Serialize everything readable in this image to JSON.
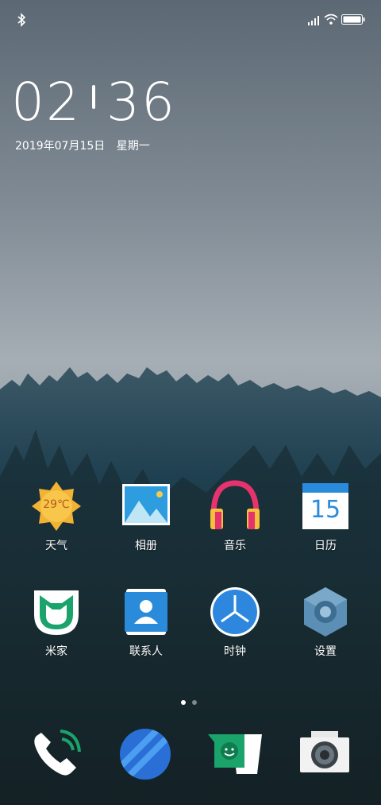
{
  "status_bar": {
    "bluetooth": "bluetooth-icon",
    "signal": "signal-icon",
    "wifi": "wifi-icon",
    "battery": "battery-icon"
  },
  "clock": {
    "hours": "02",
    "minutes": "36"
  },
  "date": {
    "day": "2019年07月15日",
    "weekday": "星期一"
  },
  "weather": {
    "temp": "29℃"
  },
  "apps_row1": [
    {
      "label": "天气",
      "icon": "weather-sun-icon"
    },
    {
      "label": "相册",
      "icon": "gallery-icon"
    },
    {
      "label": "音乐",
      "icon": "headphones-icon"
    },
    {
      "label": "日历",
      "icon": "calendar-icon",
      "day": "15"
    }
  ],
  "apps_row2": [
    {
      "label": "米家",
      "icon": "mijia-icon"
    },
    {
      "label": "联系人",
      "icon": "contacts-icon"
    },
    {
      "label": "时钟",
      "icon": "clock-icon"
    },
    {
      "label": "设置",
      "icon": "settings-gear-icon"
    }
  ],
  "page_indicator": {
    "pages": 2,
    "active": 0
  },
  "dock": [
    {
      "icon": "phone-icon"
    },
    {
      "icon": "browser-icon"
    },
    {
      "icon": "messages-icon"
    },
    {
      "icon": "camera-icon"
    }
  ],
  "colors": {
    "sky_top": "#5f6b76",
    "sky_mid": "#9aa3ab",
    "forest": "#1e3d48",
    "weather_sun": "#f2b233",
    "music_pink": "#e6326d",
    "calendar_blue": "#2a8bdb",
    "mijia_green": "#1aa36a",
    "contacts_blue": "#2a8bdb",
    "clock_blue": "#2d87df",
    "settings_blue": "#5c8fb5",
    "dock_green": "#1aa36a"
  }
}
